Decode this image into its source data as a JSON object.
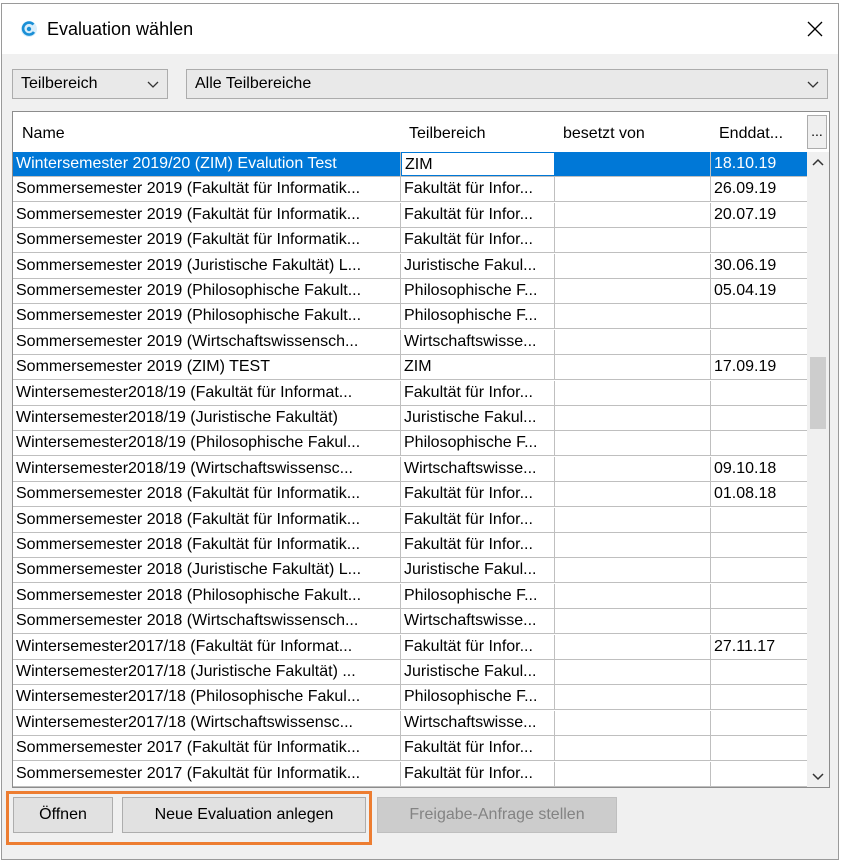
{
  "window": {
    "title": "Evaluation wählen"
  },
  "filters": {
    "scope_label": "Teilbereich",
    "scope_value": "Alle Teilbereiche"
  },
  "table": {
    "columns": [
      "Name",
      "Teilbereich",
      "besetzt von",
      "Enddat..."
    ],
    "more_button": "...",
    "rows": [
      [
        "Wintersemester 2019/20 (ZIM) Evalution Test",
        "ZIM",
        "",
        "18.10.19"
      ],
      [
        "Sommersemester 2019 (Fakultät für Informatik...",
        "Fakultät für Infor...",
        "",
        "26.09.19"
      ],
      [
        "Sommersemester 2019 (Fakultät für Informatik...",
        "Fakultät für Infor...",
        "",
        "20.07.19"
      ],
      [
        "Sommersemester 2019 (Fakultät für Informatik...",
        "Fakultät für Infor...",
        "",
        ""
      ],
      [
        "Sommersemester 2019 (Juristische Fakultät) L...",
        "Juristische Fakul...",
        "",
        "30.06.19"
      ],
      [
        "Sommersemester 2019 (Philosophische Fakult...",
        "Philosophische F...",
        "",
        "05.04.19"
      ],
      [
        "Sommersemester 2019 (Philosophische Fakult...",
        "Philosophische F...",
        "",
        ""
      ],
      [
        "Sommersemester 2019 (Wirtschaftswissensch...",
        "Wirtschaftswisse...",
        "",
        ""
      ],
      [
        "Sommersemester 2019 (ZIM) TEST",
        "ZIM",
        "",
        "17.09.19"
      ],
      [
        "Wintersemester2018/19 (Fakultät für Informat...",
        "Fakultät für Infor...",
        "",
        ""
      ],
      [
        "Wintersemester2018/19 (Juristische Fakultät)",
        "Juristische Fakul...",
        "",
        ""
      ],
      [
        "Wintersemester2018/19 (Philosophische Fakul...",
        "Philosophische F...",
        "",
        ""
      ],
      [
        "Wintersemester2018/19 (Wirtschaftswissensc...",
        "Wirtschaftswisse...",
        "",
        "09.10.18"
      ],
      [
        "Sommersemester 2018 (Fakultät für Informatik...",
        "Fakultät für Infor...",
        "",
        "01.08.18"
      ],
      [
        "Sommersemester 2018 (Fakultät für Informatik...",
        "Fakultät für Infor...",
        "",
        ""
      ],
      [
        "Sommersemester 2018 (Fakultät für Informatik...",
        "Fakultät für Infor...",
        "",
        ""
      ],
      [
        "Sommersemester 2018 (Juristische Fakultät) L...",
        "Juristische Fakul...",
        "",
        ""
      ],
      [
        "Sommersemester 2018 (Philosophische Fakult...",
        "Philosophische F...",
        "",
        ""
      ],
      [
        "Sommersemester 2018 (Wirtschaftswissensch...",
        "Wirtschaftswisse...",
        "",
        ""
      ],
      [
        "Wintersemester2017/18 (Fakultät für Informat...",
        "Fakultät für Infor...",
        "",
        "27.11.17"
      ],
      [
        "Wintersemester2017/18 (Juristische Fakultät) ...",
        "Juristische Fakul...",
        "",
        ""
      ],
      [
        "Wintersemester2017/18 (Philosophische Fakul...",
        "Philosophische F...",
        "",
        ""
      ],
      [
        "Wintersemester2017/18 (Wirtschaftswissensc...",
        "Wirtschaftswisse...",
        "",
        ""
      ],
      [
        "Sommersemester 2017 (Fakultät für Informatik...",
        "Fakultät für Infor...",
        "",
        ""
      ],
      [
        "Sommersemester 2017 (Fakultät für Informatik...",
        "Fakultät für Infor...",
        "",
        ""
      ]
    ],
    "selected_index": 0
  },
  "buttons": {
    "open": "Öffnen",
    "new": "Neue Evaluation anlegen",
    "release": "Freigabe-Anfrage stellen"
  },
  "colors": {
    "selection": "#0078d7",
    "highlight_outline": "#ed7d31"
  }
}
